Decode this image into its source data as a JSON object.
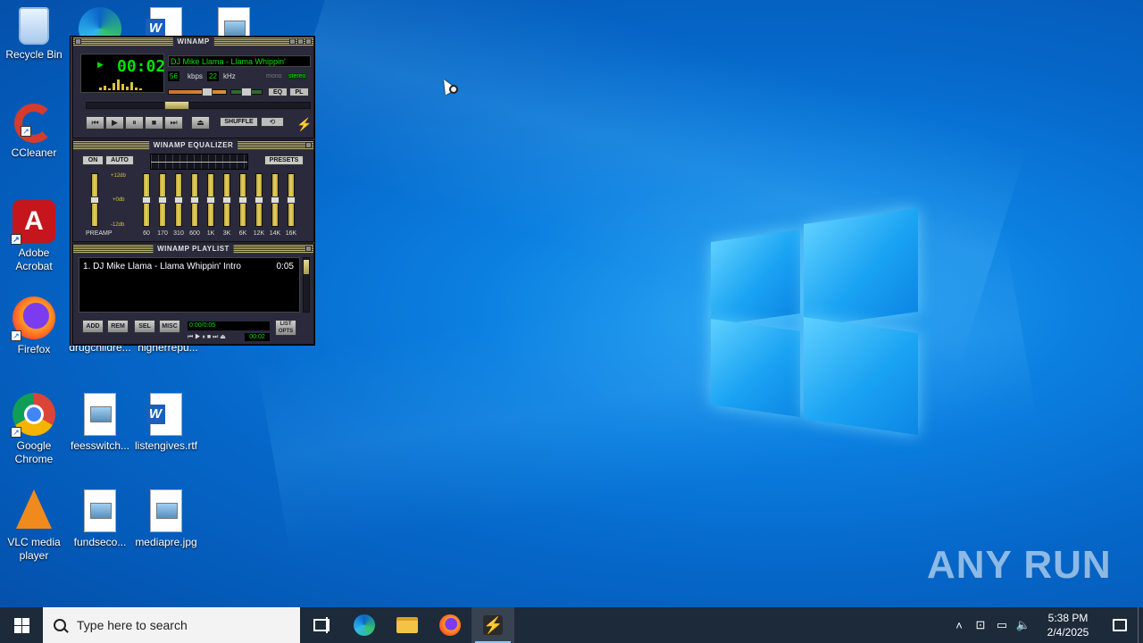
{
  "desktop": {
    "icons": [
      {
        "label": "Recycle Bin",
        "icon": "recycle-bin-icon"
      },
      {
        "label": "CCleaner",
        "icon": "ccleaner-icon"
      },
      {
        "label": "Adobe Acrobat",
        "icon": "adobe-acrobat-icon"
      },
      {
        "label": "Firefox",
        "icon": "firefox-icon"
      },
      {
        "label": "Google Chrome",
        "icon": "chrome-icon"
      },
      {
        "label": "VLC media player",
        "icon": "vlc-icon"
      },
      {
        "label": "drugchildre...",
        "icon": "document-icon"
      },
      {
        "label": "higherrepu...",
        "icon": "image-file-icon"
      },
      {
        "label": "feesswitch...",
        "icon": "image-file-icon"
      },
      {
        "label": "listengives.rtf",
        "icon": "word-document-icon"
      },
      {
        "label": "fundseco...",
        "icon": "image-file-icon"
      },
      {
        "label": "mediapre.jpg",
        "icon": "image-file-icon"
      }
    ],
    "watermark": "ANY RUN"
  },
  "winamp": {
    "title": "WINAMP",
    "time": "00:02",
    "ticker": "DJ Mike Llama - Llama Whippin'",
    "kbps": "56",
    "kbps_label": "kbps",
    "khz": "22",
    "khz_label": "kHz",
    "mono": "mono",
    "stereo": "stereo",
    "eq_toggle": "EQ",
    "pl_toggle": "PL",
    "shuffle": "SHUFFLE",
    "equalizer": {
      "title": "WINAMP EQUALIZER",
      "on": "ON",
      "auto": "AUTO",
      "presets": "PRESETS",
      "db_top": "+12db",
      "db_mid": "+0db",
      "db_bottom": "-12db",
      "preamp": "PREAMP",
      "bands": [
        "60",
        "170",
        "310",
        "600",
        "1K",
        "3K",
        "6K",
        "12K",
        "14K",
        "16K"
      ]
    },
    "playlist": {
      "title": "WINAMP PLAYLIST",
      "entries": [
        {
          "name": "1. DJ Mike Llama - Llama Whippin' Intro",
          "duration": "0:05"
        }
      ],
      "add": "ADD",
      "rem": "REM",
      "sel": "SEL",
      "misc": "MISC",
      "time_display": "0:00/0:05",
      "mini_time": "00:02",
      "list_opts": "LIST OPTS"
    }
  },
  "taskbar": {
    "search_placeholder": "Type here to search",
    "time": "5:38 PM",
    "date": "2/4/2025"
  }
}
